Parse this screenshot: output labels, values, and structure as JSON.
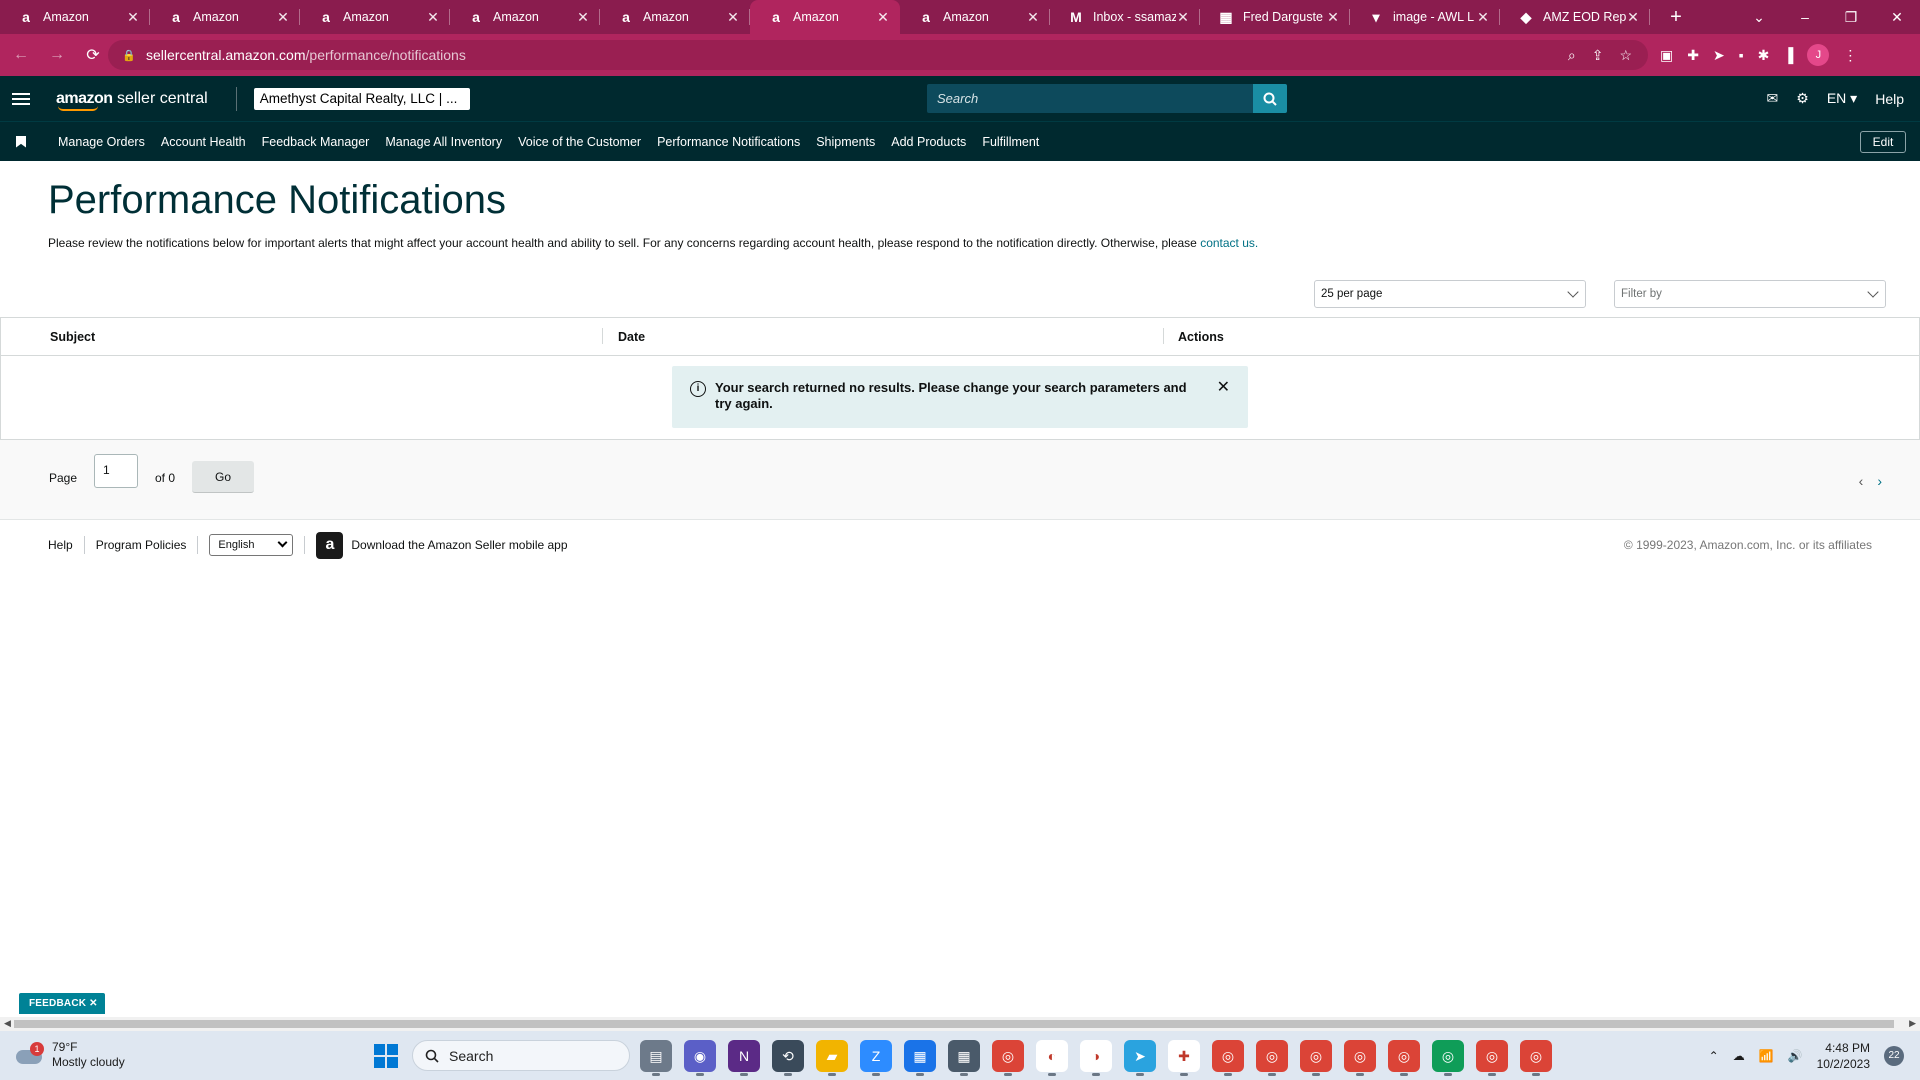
{
  "browser": {
    "tabs": [
      {
        "title": "Amazon",
        "icon": "amazon-favicon",
        "active": false
      },
      {
        "title": "Amazon",
        "icon": "amazon-favicon",
        "active": false
      },
      {
        "title": "Amazon",
        "icon": "amazon-favicon",
        "active": false
      },
      {
        "title": "Amazon",
        "icon": "amazon-favicon",
        "active": false
      },
      {
        "title": "Amazon",
        "icon": "amazon-favicon",
        "active": false
      },
      {
        "title": "Amazon",
        "icon": "amazon-favicon",
        "active": true
      },
      {
        "title": "Amazon",
        "icon": "amazon-favicon",
        "active": false
      },
      {
        "title": "Inbox - ssamaz",
        "icon": "gmail-favicon",
        "active": false
      },
      {
        "title": "Fred Darguste",
        "icon": "sheets-favicon",
        "active": false
      },
      {
        "title": "image - AWL L",
        "icon": "image-favicon",
        "active": false
      },
      {
        "title": "AMZ EOD Repo",
        "icon": "drive-favicon",
        "active": false
      }
    ],
    "url_host": "sellercentral.amazon.com",
    "url_path": "/performance/notifications",
    "profile_initial": "J",
    "colors": {
      "tab_bar": "#8a1c4e",
      "address_bar": "#b0255e"
    }
  },
  "header": {
    "logo_brand": "amazon",
    "logo_product": "seller central",
    "account": "Amethyst Capital Realty, LLC | ...",
    "search_placeholder": "Search",
    "language": "EN",
    "help": "Help"
  },
  "nav": {
    "items": [
      "Manage Orders",
      "Account Health",
      "Feedback Manager",
      "Manage All Inventory",
      "Voice of the Customer",
      "Performance Notifications",
      "Shipments",
      "Add Products",
      "Fulfillment"
    ],
    "edit": "Edit"
  },
  "main": {
    "title": "Performance Notifications",
    "intro": "Please review the notifications below for important alerts that might affect your account health and ability to sell. For any concerns regarding account health, please respond to the notification directly. Otherwise, please",
    "intro_link": "contact us.",
    "per_page": "25 per page",
    "filter_placeholder": "Filter by",
    "columns": [
      "Subject",
      "Date",
      "Actions"
    ],
    "alert": "Your search returned no results. Please change your search parameters and try again."
  },
  "pagination": {
    "page_label": "Page",
    "page_value": "1",
    "of_label": "of 0",
    "go": "Go"
  },
  "footer": {
    "help": "Help",
    "program_policies": "Program Policies",
    "language": "English",
    "app_text": "Download the Amazon Seller mobile app",
    "copyright": "© 1999-2023, Amazon.com, Inc. or its affiliates"
  },
  "feedback": "FEEDBACK",
  "taskbar": {
    "weather_temp": "79°F",
    "weather_desc": "Mostly cloudy",
    "weather_badge": "1",
    "search": "Search",
    "time": "4:48 PM",
    "date": "10/2/2023",
    "notifications": "22"
  }
}
